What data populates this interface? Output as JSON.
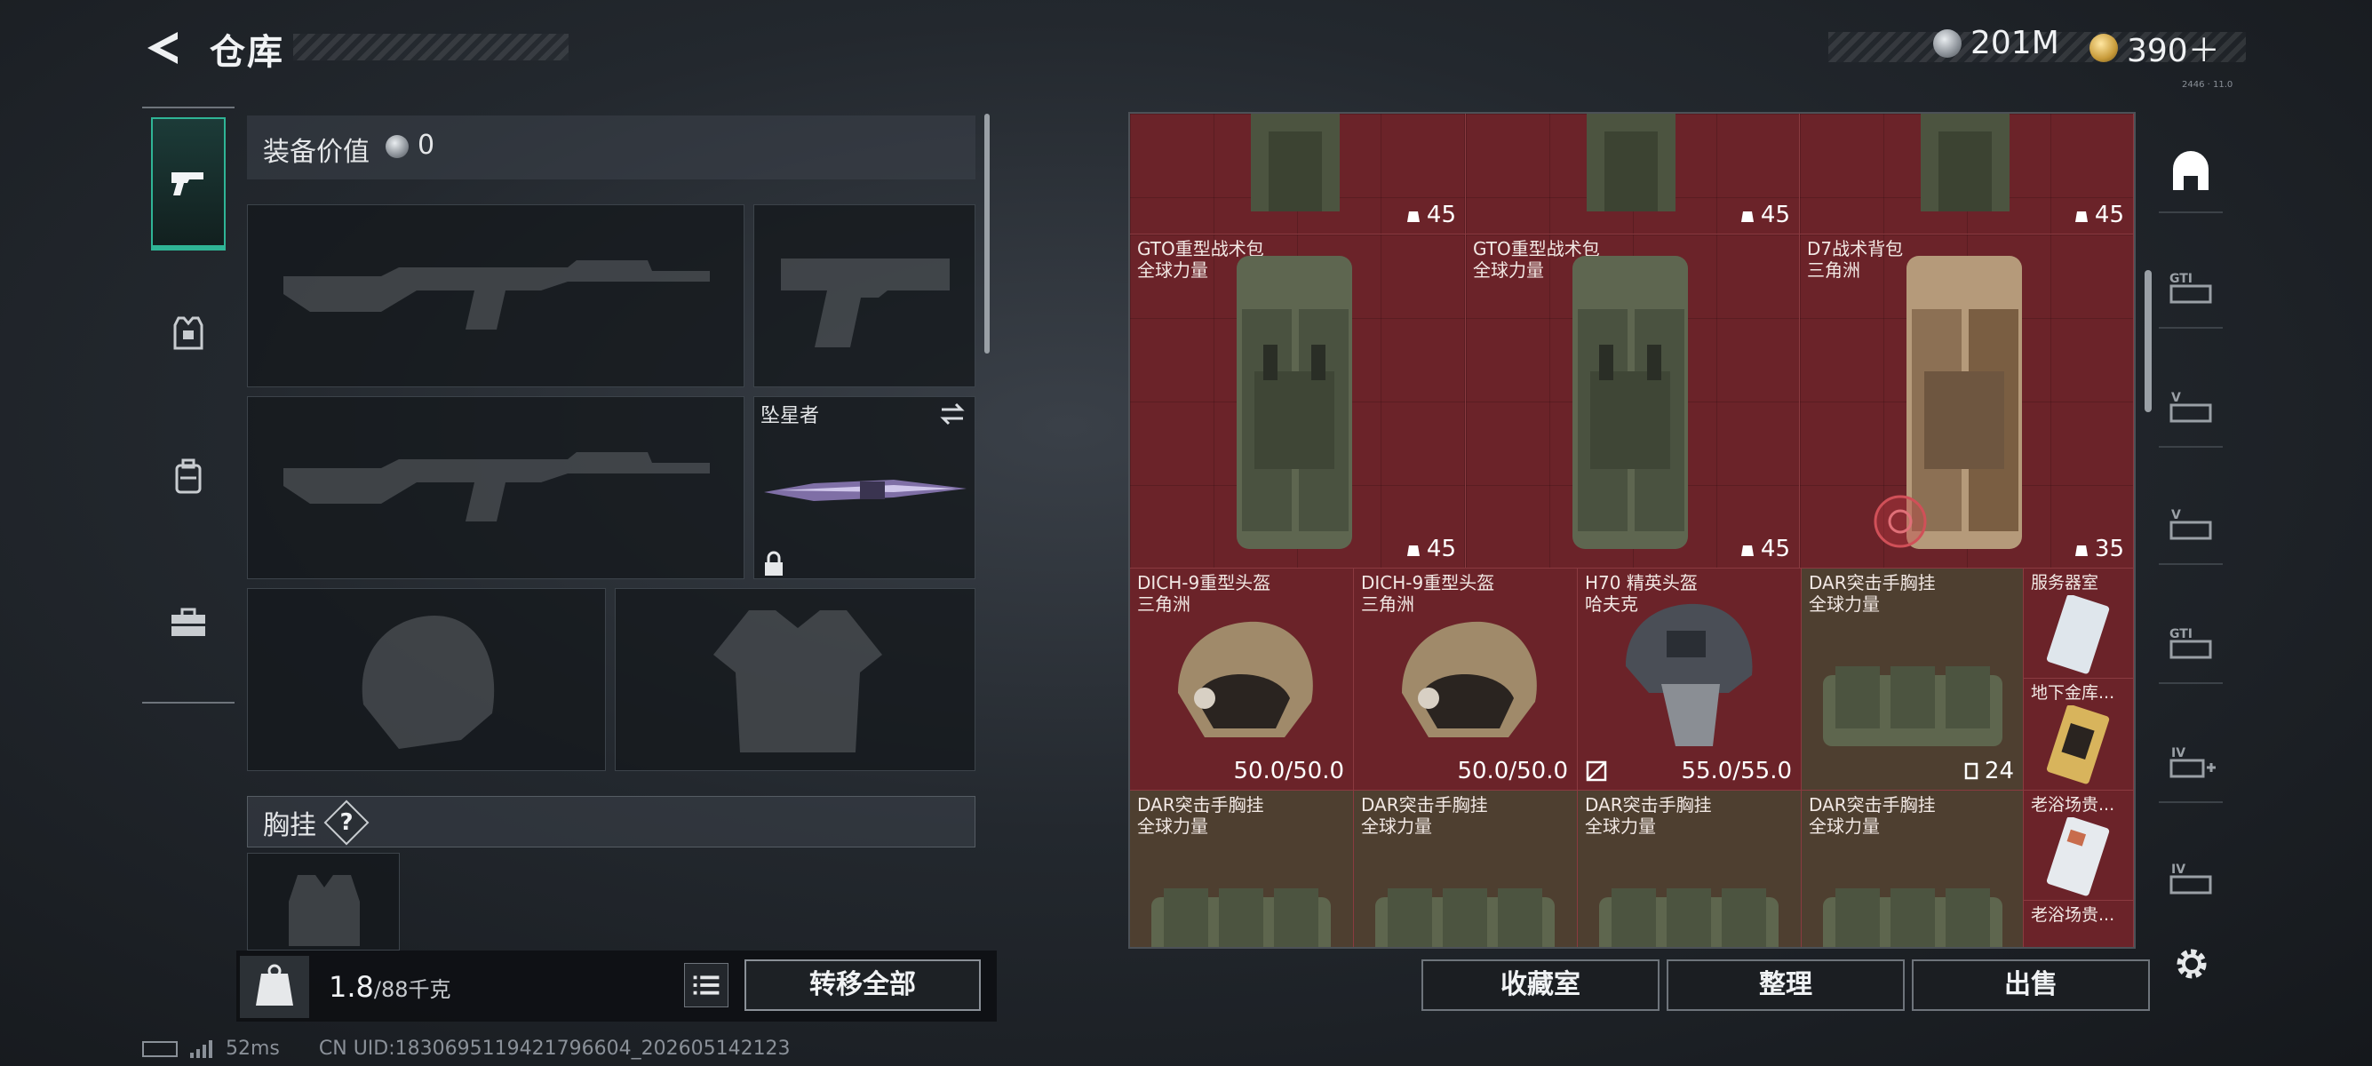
{
  "header": {
    "title": "仓库",
    "currencies": [
      {
        "icon": "silver-coin-icon",
        "value": "201M"
      },
      {
        "icon": "gold-coin-icon",
        "value": "390＋"
      }
    ],
    "server_tag": "2446 · 11.0"
  },
  "categories": [
    {
      "icon": "pistol-icon",
      "active": true
    },
    {
      "icon": "vest-icon",
      "active": false
    },
    {
      "icon": "backpack-icon",
      "active": false
    },
    {
      "icon": "toolbox-icon",
      "active": false
    }
  ],
  "loadout": {
    "equip_value_label": "装备价值",
    "equip_value": "0",
    "melee_name": "坠星者",
    "chest_label": "胸挂",
    "chest_help": "?",
    "weight_value": "1.8",
    "weight_unit": "/88千克",
    "transfer_all": "转移全部"
  },
  "storage": {
    "top_row": [
      {
        "count": "45"
      },
      {
        "count": "45"
      },
      {
        "count": "45"
      }
    ],
    "backpacks": [
      {
        "name": "GTO重型战术包",
        "source": "全球力量",
        "count": "45"
      },
      {
        "name": "GTO重型战术包",
        "source": "全球力量",
        "count": "45"
      },
      {
        "name": "D7战术背包",
        "source": "三角洲",
        "count": "35"
      }
    ],
    "row3": [
      {
        "name": "DICH-9重型头盔",
        "source": "三角洲",
        "durability": "50.0/50.0"
      },
      {
        "name": "DICH-9重型头盔",
        "source": "三角洲",
        "durability": "50.0/50.0"
      },
      {
        "name": "H70 精英头盔",
        "source": "哈夫克",
        "durability": "55.0/55.0"
      },
      {
        "name": "DAR突击手胸挂",
        "source": "全球力量",
        "count": "24"
      }
    ],
    "row4": [
      {
        "name": "DAR突击手胸挂",
        "source": "全球力量"
      },
      {
        "name": "DAR突击手胸挂",
        "source": "全球力量"
      },
      {
        "name": "DAR突击手胸挂",
        "source": "全球力量"
      },
      {
        "name": "DAR突击手胸挂",
        "source": "全球力量"
      }
    ],
    "keys": [
      {
        "name": "服务器室"
      },
      {
        "name": "地下金库..."
      },
      {
        "name": "老浴场贵..."
      },
      {
        "name": "老浴场贵..."
      }
    ]
  },
  "filters": [
    {
      "icon": "home-filter-icon"
    },
    {
      "icon": "gti-filter-icon"
    },
    {
      "icon": "v-filter-icon"
    },
    {
      "icon": "v-filter-icon-2"
    },
    {
      "icon": "gti-filter-icon-2"
    },
    {
      "icon": "iv-add-filter-icon"
    },
    {
      "icon": "iv-filter-icon"
    }
  ],
  "actions": {
    "collection": "收藏室",
    "sort": "整理",
    "sell": "出售"
  },
  "status": {
    "ping": "52ms",
    "uid": "CN UID:1830695119421796604_202605142123"
  },
  "colors": {
    "accent": "#2fb596",
    "storage_cell": "#6b2329",
    "storage_cell_alt": "#4e3f30"
  }
}
